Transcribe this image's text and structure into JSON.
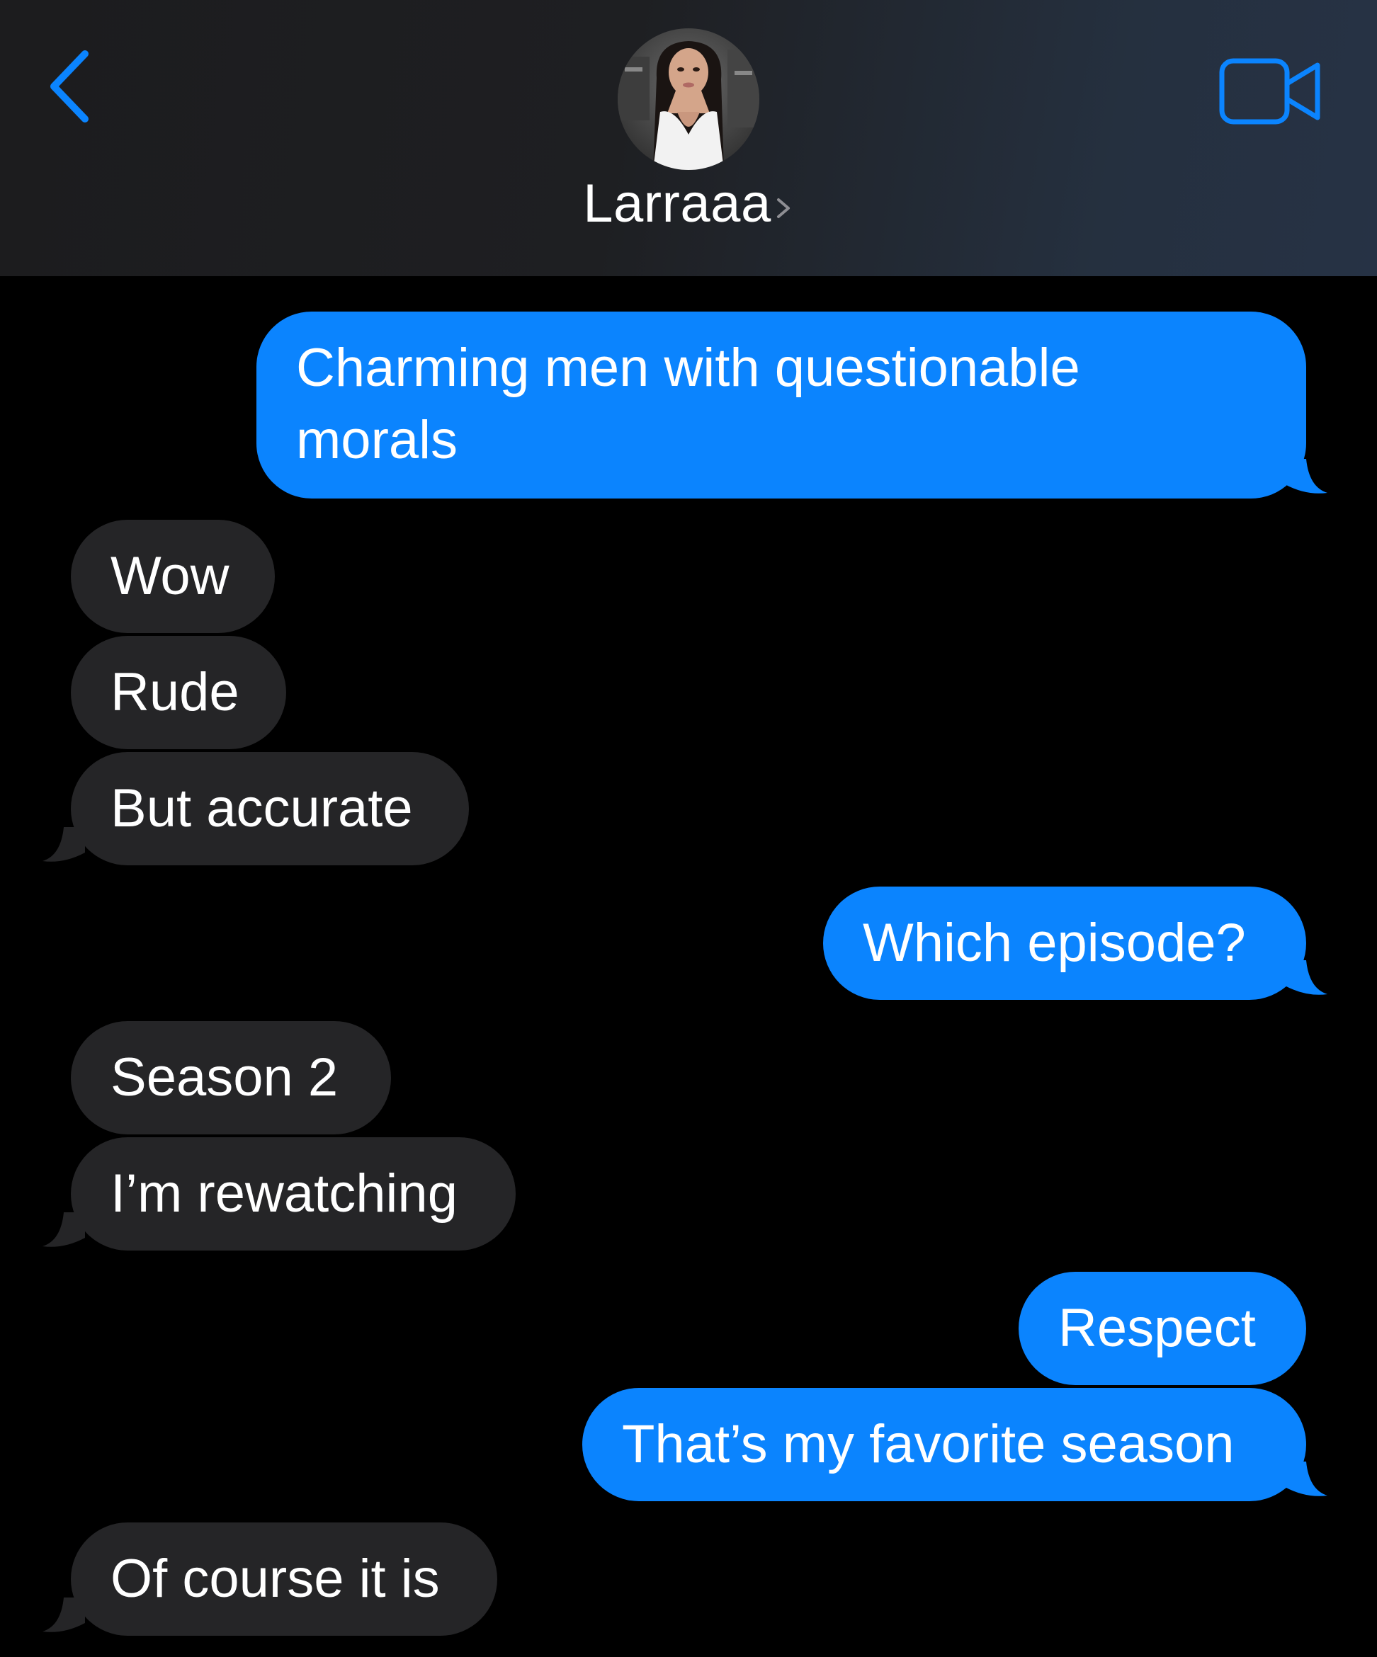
{
  "header": {
    "contact_name": "Larraaa",
    "back_icon": "chevron-left-icon",
    "video_icon": "video-camera-icon",
    "accent_color": "#0b84fe"
  },
  "colors": {
    "sent_bubble": "#0b84fe",
    "received_bubble": "#252527",
    "background": "#000000"
  },
  "messages": [
    {
      "direction": "sent",
      "text_lines": [
        "Charming men with questionable",
        "morals"
      ]
    },
    {
      "direction": "received",
      "text": "Wow"
    },
    {
      "direction": "received",
      "text": "Rude"
    },
    {
      "direction": "received",
      "text": "But accurate"
    },
    {
      "direction": "sent",
      "text": "Which episode?"
    },
    {
      "direction": "received",
      "text": "Season 2"
    },
    {
      "direction": "received",
      "text": "I’m rewatching"
    },
    {
      "direction": "sent",
      "text": "Respect"
    },
    {
      "direction": "sent",
      "text": "That’s my favorite season"
    },
    {
      "direction": "received",
      "text": "Of course it is"
    }
  ]
}
